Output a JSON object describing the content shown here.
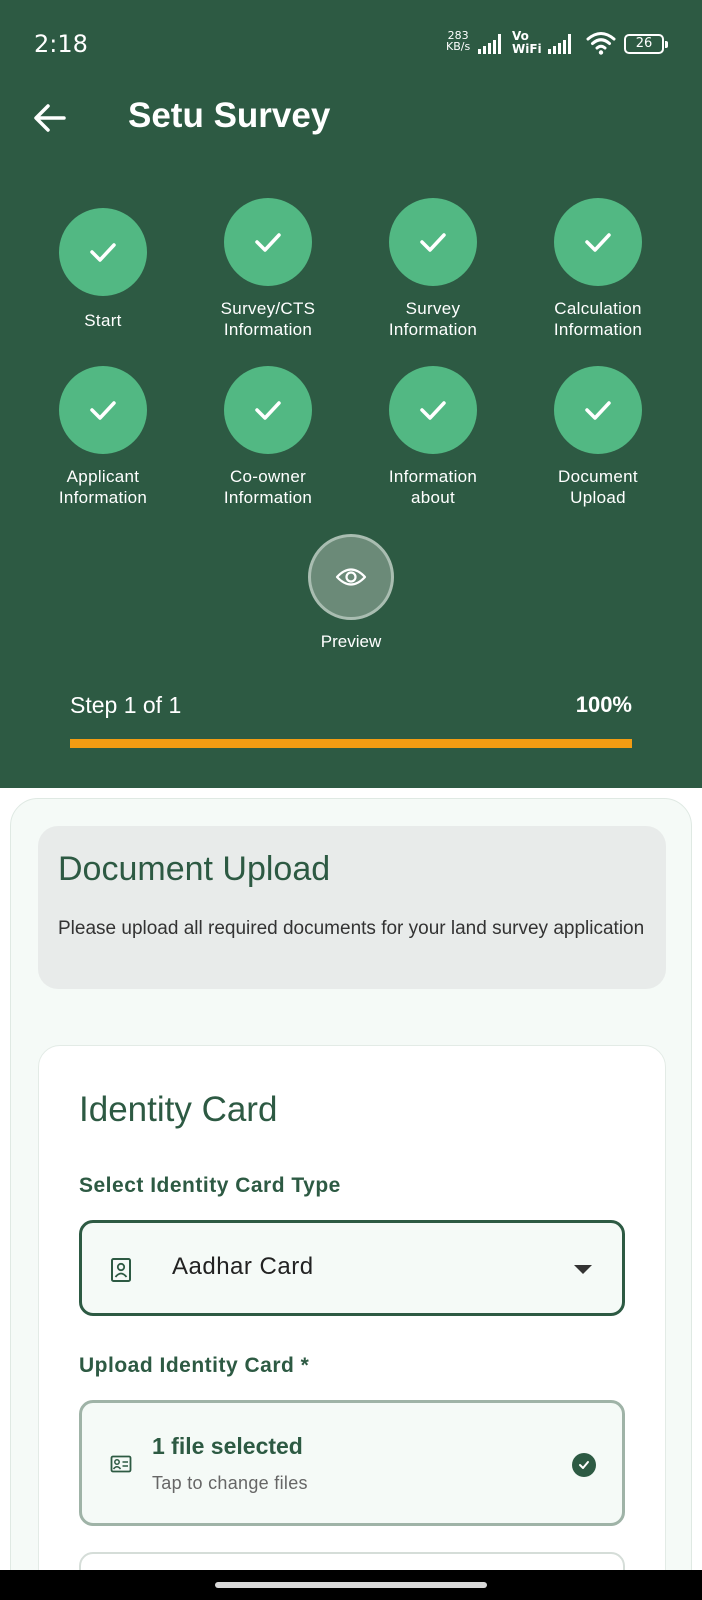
{
  "status_bar": {
    "time": "2:18",
    "net_speed_value": "283",
    "net_speed_unit": "KB/s",
    "vowifi_top": "Vo",
    "vowifi_bottom": "WiFi",
    "battery": "26"
  },
  "app_bar": {
    "title": "Setu Survey",
    "back_icon": "arrow-left-icon"
  },
  "steps": [
    {
      "label_line1": "Start",
      "label_line2": "",
      "status": "complete",
      "icon": "check-icon"
    },
    {
      "label_line1": "Survey/CTS",
      "label_line2": "Information",
      "status": "complete",
      "icon": "check-icon"
    },
    {
      "label_line1": "Survey",
      "label_line2": "Information",
      "status": "complete",
      "icon": "check-icon"
    },
    {
      "label_line1": "Calculation",
      "label_line2": "Information",
      "status": "complete",
      "icon": "check-icon"
    },
    {
      "label_line1": "Applicant",
      "label_line2": "Information",
      "status": "complete",
      "icon": "check-icon"
    },
    {
      "label_line1": "Co-owner",
      "label_line2": "Information",
      "status": "complete",
      "icon": "check-icon"
    },
    {
      "label_line1": "Information",
      "label_line2": "about",
      "status": "complete",
      "icon": "check-icon"
    },
    {
      "label_line1": "Document",
      "label_line2": "Upload",
      "status": "complete",
      "icon": "check-icon"
    }
  ],
  "preview": {
    "label": "Preview",
    "icon": "eye-icon"
  },
  "progress": {
    "step_text": "Step 1 of 1",
    "percent_text": "100%",
    "fraction": 1.0
  },
  "intro": {
    "title": "Document Upload",
    "description": "Please upload all required documents for your land survey application"
  },
  "identity_card": {
    "title": "Identity Card",
    "select_label": "Select Identity Card Type",
    "select_value": "Aadhar Card",
    "select_icon": "id-badge-icon",
    "upload_label": "Upload Identity Card *",
    "upload_status": "1 file selected",
    "upload_hint": "Tap to change files",
    "upload_icon": "id-card-icon"
  },
  "colors": {
    "header_bg": "#2d5a43",
    "step_complete": "#52b883",
    "progress_fill": "#f39c12",
    "accent_text": "#2d5a43"
  }
}
